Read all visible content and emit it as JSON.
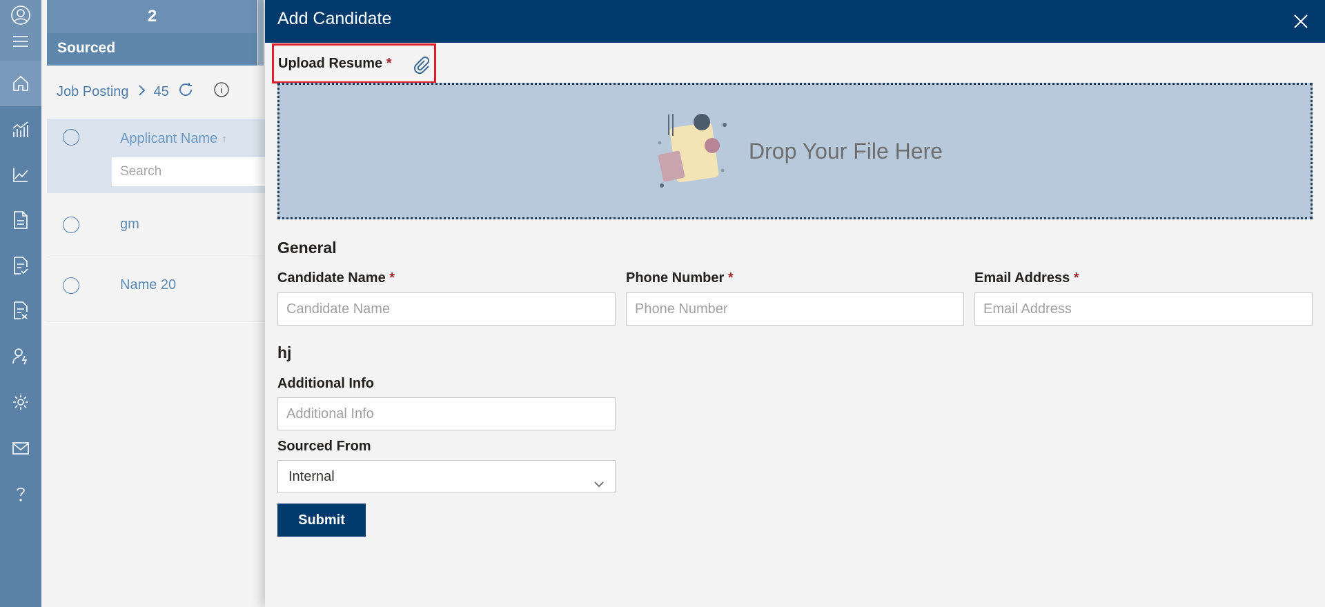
{
  "nav": {
    "icons": [
      "user-avatar-icon",
      "hamburger-menu-icon",
      "home-icon",
      "analytics-icon",
      "line-chart-icon",
      "document-icon",
      "document-check-icon",
      "document-x-icon",
      "user-assign-icon",
      "gear-icon",
      "mail-icon",
      "help-icon"
    ]
  },
  "background": {
    "stage_count": "2",
    "stage_name": "Sourced",
    "breadcrumb": {
      "root": "Job Posting",
      "id": "45"
    },
    "table": {
      "column": "Applicant Name",
      "sort": "↑",
      "search_placeholder": "Search",
      "rows": [
        "gm",
        "Name 20"
      ]
    }
  },
  "drawer": {
    "title": "Add Candidate",
    "upload_label": "Upload Resume",
    "required_mark": "*",
    "dropzone_text": "Drop Your File Here",
    "section_general": "General",
    "fields": {
      "candidate_name": {
        "label": "Candidate Name",
        "placeholder": "Candidate Name"
      },
      "phone_number": {
        "label": "Phone Number",
        "placeholder": "Phone Number"
      },
      "email_address": {
        "label": "Email Address",
        "placeholder": "Email Address"
      }
    },
    "section_custom": "hj",
    "additional_info": {
      "label": "Additional Info",
      "placeholder": "Additional Info"
    },
    "sourced_from": {
      "label": "Sourced From",
      "value": "Internal"
    },
    "submit_label": "Submit"
  },
  "colors": {
    "header_bg": "#003a6c",
    "rail_bg": "#5b82a6",
    "dropzone_bg": "#b7c9da",
    "required": "#a4262c",
    "highlight_box": "#e11d2a"
  }
}
